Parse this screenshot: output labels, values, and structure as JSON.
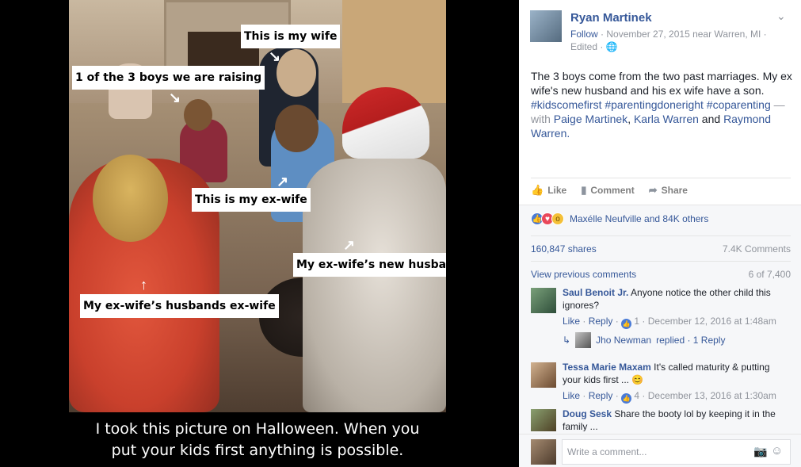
{
  "photo": {
    "labels": {
      "wife": "This is my wife",
      "boy": "1 of the 3 boys we are raising",
      "ex_wife": "This is my ex-wife",
      "new_husband": "My ex-wife’s new husband",
      "husbands_ex": "My ex-wife’s husbands ex-wife"
    },
    "caption_line1": "I took this picture on Halloween.  When you",
    "caption_line2": "put your kids first anything is possible."
  },
  "post": {
    "author": "Ryan Martinek",
    "follow": "Follow",
    "meta_date": " · November 27, 2015 near Warren, MI ·",
    "edited": "Edited ·",
    "text": "The 3 boys come from the two past marriages. My ex wife's new husband and his ex wife have a son. ",
    "hashtags": "#kidscomefirst #parentingdoneright #coparenting",
    "with_prefix": " — with ",
    "tag1": "Paige Martinek",
    "sep1": ", ",
    "tag2": "Karla Warren",
    "and": " and ",
    "tag3": "Raymond Warren."
  },
  "actions": {
    "like": "Like",
    "comment": "Comment",
    "share": "Share"
  },
  "stats": {
    "reactions_text": "Maxélle Neufville and 84K others",
    "shares": "160,847 shares",
    "comments": "7.4K Comments",
    "view_previous": "View previous comments",
    "page_count": "6 of 7,400"
  },
  "comments": [
    {
      "author": "Saul Benoit Jr.",
      "text": " Anyone notice the other child this ignores?",
      "like": "Like",
      "reply": "Reply",
      "likes": "1",
      "date": " · December 12, 2016 at 1:48am",
      "reply_author": "Jho Newman",
      "reply_text": " replied · 1 Reply"
    },
    {
      "author": "Tessa Marie Maxam",
      "text": " It's called maturity & putting your kids first ... 😊",
      "like": "Like",
      "reply": "Reply",
      "likes": "4",
      "date": " · December 13, 2016 at 1:30am"
    },
    {
      "author": "Doug Sesk",
      "text": " Share the booty lol by keeping it in the family ..."
    }
  ],
  "composer": {
    "placeholder": "Write a comment..."
  },
  "icons": {
    "like": "thumbs-up-icon",
    "comment": "comment-icon",
    "share": "share-arrow-icon",
    "camera": "camera-icon",
    "emoji": "emoji-icon"
  },
  "colors": {
    "link": "#365899",
    "muted": "#90949c",
    "text": "#1d2129",
    "like_blue": "#4a7bd6",
    "love_red": "#e9475a",
    "wow_yellow": "#f4c038"
  }
}
